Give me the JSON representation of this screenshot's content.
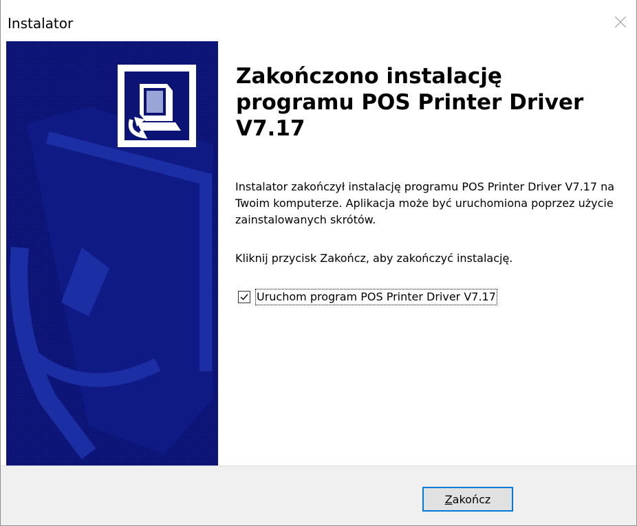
{
  "window": {
    "title": "Instalator",
    "close_icon": "close-icon"
  },
  "colors": {
    "side_panel": "#0b1475",
    "button_border": "#0078d7",
    "footer_bg": "#f0f0f0"
  },
  "main": {
    "heading": "Zakończono instalację programu POS Printer Driver V7.17",
    "description": "Instalator zakończył instalację programu POS Printer Driver V7.17 na Twoim komputerze. Aplikacja może być uruchomiona poprzez użycie zainstalowanych skrótów.",
    "instruction": "Kliknij przycisk Zakończ, aby zakończyć instalację.",
    "launch_checkbox": {
      "label": "Uruchom program POS Printer Driver V7.17",
      "checked": true
    }
  },
  "footer": {
    "finish_button": {
      "mnemonic": "Z",
      "rest": "akończ"
    }
  }
}
